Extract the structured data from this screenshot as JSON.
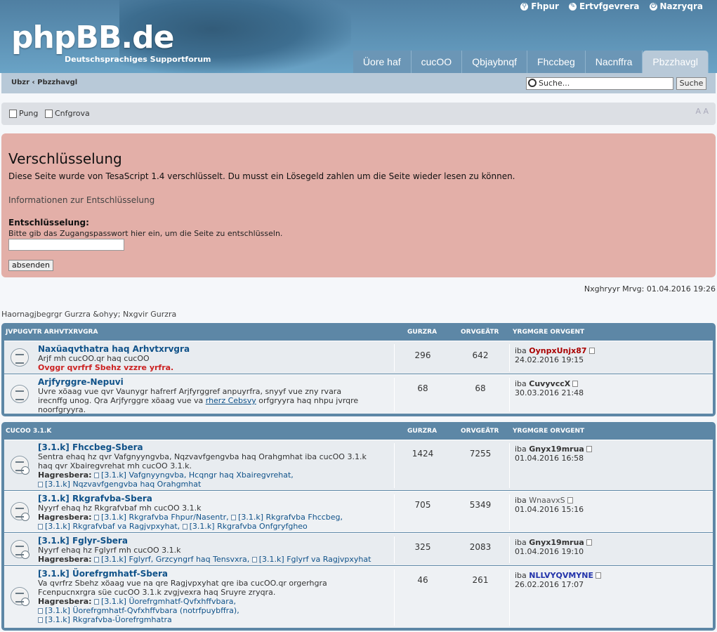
{
  "header": {
    "logo": "phpBB.de",
    "logo_sub": "Deutschsprachiges Supportforum",
    "userlinks": [
      "Fhpur",
      "Ertvfgevrera",
      "Nazryqra"
    ],
    "tabs": [
      "Üore haf",
      "cucOO",
      "Qbjaybnqf",
      "Fhccbeg",
      "Nacnffra",
      "Pbzzhavgl"
    ]
  },
  "navbar": {
    "breadcrumb": "Ubzr ‹ Pbzzhavgl",
    "search_placeholder": "Suche...",
    "search_button": "Suche"
  },
  "actions": {
    "faq": "Pung",
    "rules": "Cnfgrova",
    "fontsize": "A A"
  },
  "ransom": {
    "title": "Verschlüsselung",
    "line1": "Diese Seite wurde von TesaScript 1.4 verschlüsselt. Du musst ein Lösegeld zahlen um die Seite wieder lesen zu können.",
    "line2": "Informationen zur Entschlüsselung",
    "label": "Entschlüsselung:",
    "hint": "Bitte gib das Zugangspasswort hier ein, um die Seite zu entschlüsseln.",
    "button": "absenden"
  },
  "timestamp": "Nxghryyr Mrvg: 01.04.2016 19:26",
  "links": "Haornagjbegrgr Gurzra &ohyy; Nxgvir Gurzra",
  "sections": [
    {
      "title": "JVPUGVTR ARHVTXRVGRA",
      "col_topics": "GURZRA",
      "col_posts": "ORVGEÄTR",
      "col_last": "YRGMGRE ORVGENT",
      "forums": [
        {
          "name": "Naxüaqvthatra haq Arhvtxrvgra",
          "desc": "Arjf mh cucOO.qr haq cucOO",
          "warn": "Ovggr qvrfrf Sbehz vzzre yrfra.",
          "topics": "296",
          "posts": "642",
          "by": "iba",
          "user": "OynpxUnjx87",
          "date": "24.02.2016 19:15"
        },
        {
          "name": "Arjfyrggre-Nepuvi",
          "desc1": "Uvre xöaag vue qvr Vaunygr hafrerf Arjfyrggref anpuyrfra, snyyf vue zny rvara",
          "desc2a": "irecnffg unog. Qra Arjfyrggre xöaag vue va ",
          "desc2link": "rherz Cebsvy",
          "desc2b": " orfgryyra haq nhpu jvrqre",
          "desc3": "noorfgryyra.",
          "topics": "68",
          "posts": "68",
          "by": "iba",
          "user": "CuvyvccX",
          "date": "30.03.2016 21:48"
        }
      ]
    },
    {
      "title": "CUCOO 3.1.K",
      "col_topics": "GURZRA",
      "col_posts": "ORVGEÄTR",
      "col_last": "YRGMGRE ORVGENT",
      "forums": [
        {
          "name": "[3.1.k] Fhccbeg-Sbera",
          "desc1": "Sentra ehaq hz qvr Vafgnyyngvba, Nqzvavfgengvba haq Orahgmhat iba cucOO 3.1.k",
          "desc2": "haq qvr Xbairegvrehat mh cucOO 3.1.k.",
          "subs_label": "Hagresbera:",
          "subs": [
            "[3.1.k] Vafgnyyngvba, Hcqngr haq Xbairegvrehat,",
            "[3.1.k] Nqzvavfgengvba haq Orahgmhat"
          ],
          "topics": "1424",
          "posts": "7255",
          "by": "iba",
          "user": "Gnyx19mrua",
          "date": "01.04.2016 16:58"
        },
        {
          "name": "[3.1.k] Rkgrafvba-Sbera",
          "desc1": "Nyyrf ehaq hz Rkgrafvbaf mh cucOO 3.1.k",
          "subs_label": "Hagresbera:",
          "subs": [
            "[3.1.k] Rkgrafvba Fhpur/Nasentr,",
            "[3.1.k] Rkgrafvba Fhccbeg,",
            "[3.1.k] Rkgrafvbaf va Ragjvpxyhat,",
            "[3.1.k] Rkgrafvba Onfgryfgheo"
          ],
          "topics": "705",
          "posts": "5349",
          "by": "iba",
          "user": "WnaavxS",
          "date": "01.04.2016 15:16"
        },
        {
          "name": "[3.1.k] Fglyr-Sbera",
          "desc1": "Nyyrf ehaq hz Fglyrf mh cucOO 3.1.k",
          "subs_label": "Hagresbera:",
          "subs": [
            "[3.1.k] Fglyrf, Grzcyngrf haq Tensvxra,",
            "[3.1.k] Fglyrf va Ragjvpxyhat"
          ],
          "topics": "325",
          "posts": "2083",
          "by": "iba",
          "user": "Gnyx19mrua",
          "date": "01.04.2016 19:10"
        },
        {
          "name": "[3.1.k] Üorefrgmhatf-Sbera",
          "desc1": "Va qvrfrz Sbehz xöaag vue na qre Ragjvpxyhat qre iba cucOO.qr orgerhgra",
          "desc2": "Fcenpucnxrgra süe cucOO 3.1.k zvgjvexra haq Sruyre zryqra.",
          "subs_label": "Hagresbera:",
          "subs": [
            "[3.1.k] Üorefrgmhatf-Qvfxhffvbara,",
            "[3.1.k] Üorefrgmhatf-Qvfxhffvbara (notrfpuybffra),",
            "[3.1.k] Rkgrafvba-Üorefrgmhatra"
          ],
          "topics": "46",
          "posts": "261",
          "by": "iba",
          "user": "NLLVYQVMYNE",
          "date": "26.02.2016 17:07"
        }
      ]
    }
  ],
  "colors": {
    "header": "#4f7fa2",
    "navbar": "#b8c9d8",
    "ransom_bg": "#e3afa8",
    "forum_frame": "#5d87a6"
  }
}
